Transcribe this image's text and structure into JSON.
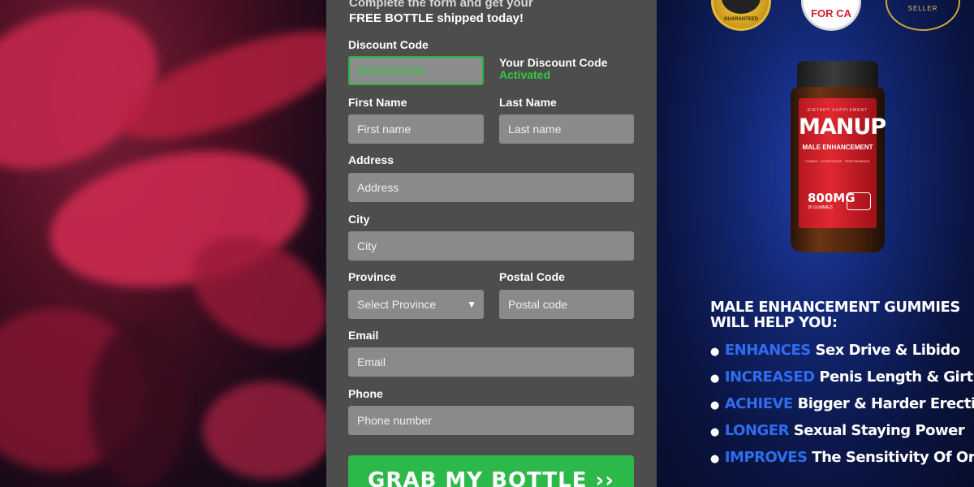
{
  "form": {
    "intro_line1": "Complete the form and get your",
    "intro_line2": "FREE BOTTLE shipped today!",
    "discount_label": "Discount Code",
    "discount_value": "BS31910296",
    "discount_status_title": "Your Discount Code",
    "discount_status_value": "Activated",
    "first_name_label": "First Name",
    "first_name_placeholder": "First name",
    "last_name_label": "Last Name",
    "last_name_placeholder": "Last name",
    "address_label": "Address",
    "address_placeholder": "Address",
    "city_label": "City",
    "city_placeholder": "City",
    "province_label": "Province",
    "province_selected": "Select Province",
    "postal_label": "Postal Code",
    "postal_placeholder": "Postal code",
    "email_label": "Email",
    "email_placeholder": "Email",
    "phone_label": "Phone",
    "phone_placeholder": "Phone number",
    "submit_label": "GRAB MY BOTTLE ››"
  },
  "badges": {
    "gold": "GUARANTEED",
    "canada": "FOR CA",
    "seller": "SELLER"
  },
  "product": {
    "small_text": "DIETARY SUPPLEMENT",
    "brand": "MANUP",
    "subtitle": "MALE ENHANCEMENT",
    "tagline": "POWER · CONFIDENCE · PERFORMANCE",
    "dose": "800MG",
    "count": "30 GUMMIES"
  },
  "benefits": {
    "headline": "MALE ENHANCEMENT GUMMIES WILL HELP YOU:",
    "items": [
      {
        "highlight": "ENHANCES",
        "text": "Sex Drive & Libido"
      },
      {
        "highlight": "INCREASED",
        "text": "Penis Length & Girth"
      },
      {
        "highlight": "ACHIEVE",
        "text": "Bigger & Harder Erections"
      },
      {
        "highlight": "LONGER",
        "text": "Sexual Staying Power"
      },
      {
        "highlight": "IMPROVES",
        "text": "The Sensitivity Of Orgasm"
      }
    ]
  },
  "colors": {
    "accent_green": "#2db84a",
    "activated_green": "#2ecc40",
    "highlight_blue": "#2f6cf0",
    "form_bg": "#4d4d4d"
  }
}
